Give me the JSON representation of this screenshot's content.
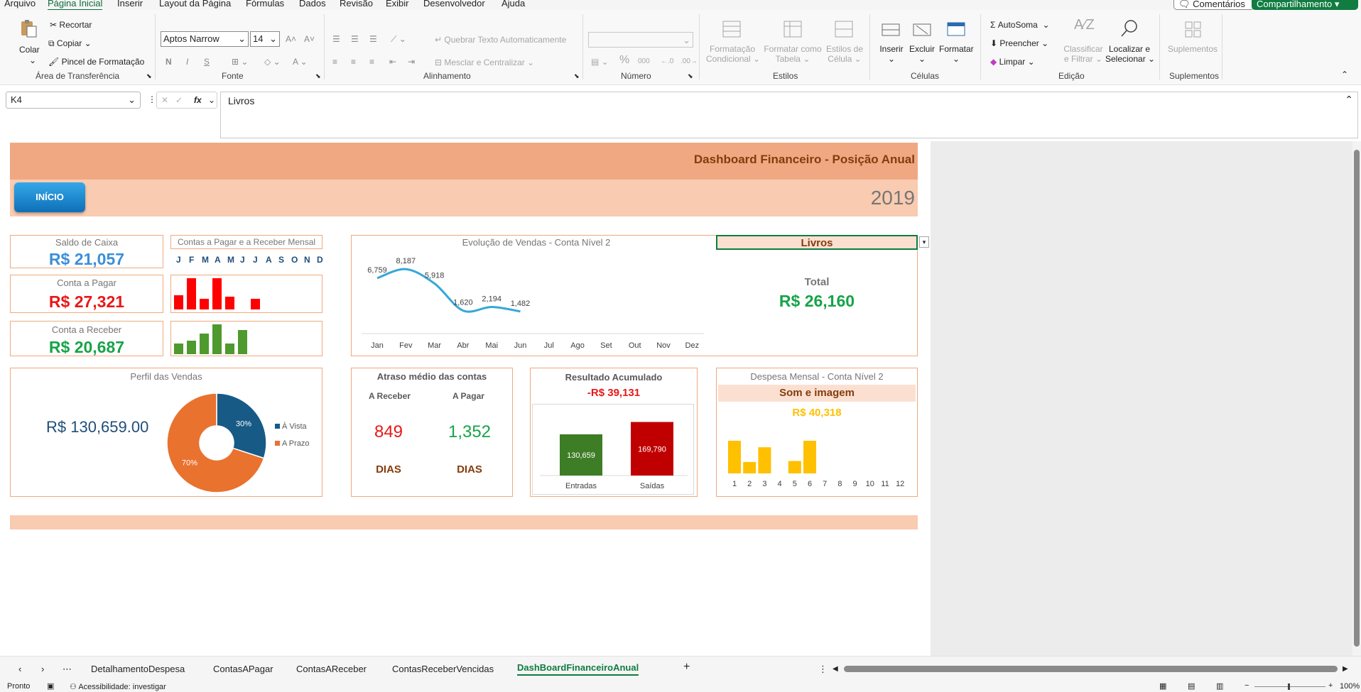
{
  "menu": [
    "Arquivo",
    "Página Inicial",
    "Inserir",
    "Layout da Página",
    "Fórmulas",
    "Dados",
    "Revisão",
    "Exibir",
    "Desenvolvedor",
    "Ajuda"
  ],
  "topbar": {
    "comments": "Comentários",
    "share": "Compartilhamento"
  },
  "ribbon": {
    "paste": "Colar",
    "cut": "Recortar",
    "copy": "Copiar",
    "painter": "Pincel de Formatação",
    "clipboard_group": "Área de Transferência",
    "font_name": "Aptos Narrow",
    "font_size": "14",
    "font_group": "Fonte",
    "bold": "N",
    "italic": "I",
    "underline": "S",
    "wrap": "Quebrar Texto Automaticamente",
    "merge": "Mesclar e Centralizar",
    "align_group": "Alinhamento",
    "percent": "%",
    "thousands": "000",
    "number_group": "Número",
    "cond_format_1": "Formatação",
    "cond_format_2": "Condicional",
    "format_table_1": "Formatar como",
    "format_table_2": "Tabela",
    "cell_styles_1": "Estilos de",
    "cell_styles_2": "Célula",
    "styles_group": "Estilos",
    "insert": "Inserir",
    "delete": "Excluir",
    "format": "Formatar",
    "cells_group": "Células",
    "autosum": "AutoSoma",
    "fill": "Preencher",
    "clear": "Limpar",
    "sort_1": "Classificar",
    "sort_2": "e Filtrar",
    "find_1": "Localizar e",
    "find_2": "Selecionar",
    "edit_group": "Edição",
    "addins": "Suplementos",
    "addins_group": "Suplementos"
  },
  "formula_bar": {
    "cell_ref": "K4",
    "fx": "fx",
    "content": "Livros"
  },
  "dashboard": {
    "title": "Dashboard Financeiro - Posição Anual",
    "start_button": "INÍCIO",
    "year": "2019",
    "cash": {
      "label": "Saldo de Caixa",
      "value": "R$ 21,057"
    },
    "payable": {
      "label": "Conta a Pagar",
      "value": "R$ 27,321"
    },
    "receivable": {
      "label": "Conta a Receber",
      "value": "R$ 20,687"
    },
    "monthly": {
      "title": "Contas a Pagar e a Receber Mensal",
      "months": [
        "J",
        "F",
        "M",
        "A",
        "M",
        "J",
        "J",
        "A",
        "S",
        "O",
        "N",
        "D"
      ],
      "payable_levels": [
        0.45,
        1.0,
        0.35,
        1.0,
        0.4,
        0,
        0.35,
        0,
        0,
        0,
        0,
        0
      ],
      "receivable_levels": [
        0.35,
        0.45,
        0.7,
        1.0,
        0.35,
        0.8,
        0,
        0,
        0,
        0,
        0,
        0
      ],
      "payable_color": "#ff0000",
      "receivable_color": "#4e9a2e"
    },
    "sales": {
      "title": "Evolução de Vendas - Conta Nível 2",
      "line_color": "#35a8d8"
    },
    "selector": {
      "value": "Livros",
      "total_label": "Total",
      "total_value": "R$ 26,160"
    },
    "profile": {
      "title": "Perfil das Vendas",
      "amount": "R$ 130,659.00"
    },
    "delay": {
      "title": "Atraso médio das contas",
      "col1": "A Receber",
      "col2": "A Pagar",
      "val1": "849",
      "val2": "1,352",
      "unit1": "DIAS",
      "unit2": "DIAS"
    },
    "result": {
      "title": "Resultado Acumulado",
      "value": "-R$ 39,131"
    },
    "expense": {
      "title": "Despesa Mensal - Conta Nível 2",
      "category": "Som e imagem",
      "value": "R$ 40,318",
      "bar_color": "#ffc000"
    }
  },
  "chart_data": [
    {
      "type": "line",
      "title": "Evolução de Vendas - Conta Nível 2",
      "categories": [
        "Jan",
        "Fev",
        "Mar",
        "Abr",
        "Mai",
        "Jun",
        "Jul",
        "Ago",
        "Set",
        "Out",
        "Nov",
        "Dez"
      ],
      "values": [
        6759,
        8187,
        5918,
        1620,
        2194,
        1482,
        null,
        null,
        null,
        null,
        null,
        null
      ],
      "data_labels": [
        "6,759",
        "8,187",
        "5,918",
        "1,620",
        "2,194",
        "1,482"
      ]
    },
    {
      "type": "pie",
      "title": "Perfil das Vendas",
      "slices": [
        {
          "name": "À Vista",
          "value": 30,
          "label": "30%",
          "color": "#175a86"
        },
        {
          "name": "A Prazo",
          "value": 70,
          "label": "70%",
          "color": "#e9722f"
        }
      ]
    },
    {
      "type": "bar",
      "title": "Resultado Acumulado",
      "categories": [
        "Entradas",
        "Saídas"
      ],
      "values": [
        130659,
        169790
      ],
      "data_labels": [
        "130,659",
        "169,790"
      ],
      "colors": [
        "#3d7d25",
        "#c00000"
      ]
    },
    {
      "type": "bar",
      "title": "Despesa Mensal - Conta Nível 2",
      "categories": [
        "1",
        "2",
        "3",
        "4",
        "5",
        "6",
        "7",
        "8",
        "9",
        "10",
        "11",
        "12"
      ],
      "values": [
        1.0,
        0.35,
        0.8,
        0,
        0.38,
        1.0,
        0,
        0,
        0,
        0,
        0,
        0
      ]
    }
  ],
  "sheet_tabs": [
    "DetalhamentoDespesa",
    "ContasAPagar",
    "ContasAReceber",
    "ContasReceberVencidas",
    "DashBoardFinanceiroAnual"
  ],
  "status": {
    "ready": "Pronto",
    "accessibility": "Acessibilidade: investigar",
    "zoom": "100%"
  }
}
